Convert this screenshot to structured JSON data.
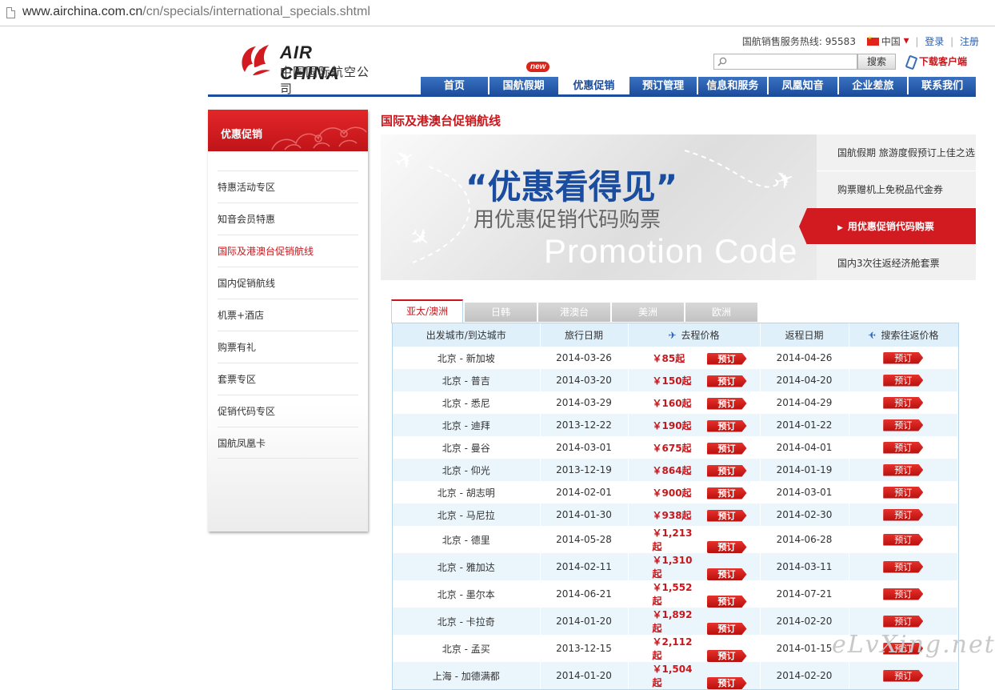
{
  "browser": {
    "url_host": "www.airchina.com.cn",
    "url_path": "/cn/specials/international_specials.shtml"
  },
  "brand": {
    "name_en": "AIR CHINA",
    "name_cn": "中国国际航空公司"
  },
  "topbar": {
    "hotline": "国航销售服务热线: 95583",
    "language": "中国",
    "login": "登录",
    "register": "注册",
    "search_button": "搜索",
    "search_placeholder": "",
    "download": "下载客户端"
  },
  "nav": {
    "new_badge": "new",
    "items": [
      {
        "label": "首页"
      },
      {
        "label": "国航假期"
      },
      {
        "label": "优惠促销"
      },
      {
        "label": "预订管理"
      },
      {
        "label": "信息和服务"
      },
      {
        "label": "凤凰知音"
      },
      {
        "label": "企业差旅"
      },
      {
        "label": "联系我们"
      }
    ]
  },
  "sidebar": {
    "title": "优惠促销",
    "items": [
      {
        "label": "特惠活动专区"
      },
      {
        "label": "知音会员特惠"
      },
      {
        "label": "国际及港澳台促销航线"
      },
      {
        "label": "国内促销航线"
      },
      {
        "label": "机票+酒店"
      },
      {
        "label": "购票有礼"
      },
      {
        "label": "套票专区"
      },
      {
        "label": "促销代码专区"
      },
      {
        "label": "国航凤凰卡"
      }
    ]
  },
  "page": {
    "title": "国际及港澳台促销航线"
  },
  "banner": {
    "headline": "“优惠看得见”",
    "subline": "用优惠促销代码购票",
    "english": "Promotion  Code",
    "side_items": [
      {
        "label": "国航假期 旅游度假预订上佳之选"
      },
      {
        "label": "购票赠机上免税品代金券"
      },
      {
        "label": "用优惠促销代码购票"
      },
      {
        "label": "国内3次往返经济舱套票"
      }
    ]
  },
  "tabs": [
    {
      "label": "亚太/澳洲"
    },
    {
      "label": "日韩"
    },
    {
      "label": "港澳台"
    },
    {
      "label": "美洲"
    },
    {
      "label": "欧洲"
    }
  ],
  "table": {
    "headers": [
      "出发城市/到达城市",
      "旅行日期",
      "去程价格",
      "返程日期",
      "搜索往返价格"
    ],
    "book_label": "预订",
    "rows": [
      {
        "route": "北京 - 新加坡",
        "date": "2014-03-26",
        "price": "￥85起",
        "return": "2014-04-26"
      },
      {
        "route": "北京 - 普吉",
        "date": "2014-03-20",
        "price": "￥150起",
        "return": "2014-04-20"
      },
      {
        "route": "北京 - 悉尼",
        "date": "2014-03-29",
        "price": "￥160起",
        "return": "2014-04-29"
      },
      {
        "route": "北京 - 迪拜",
        "date": "2013-12-22",
        "price": "￥190起",
        "return": "2014-01-22"
      },
      {
        "route": "北京 - 曼谷",
        "date": "2014-03-01",
        "price": "￥675起",
        "return": "2014-04-01"
      },
      {
        "route": "北京 - 仰光",
        "date": "2013-12-19",
        "price": "￥864起",
        "return": "2014-01-19"
      },
      {
        "route": "北京 - 胡志明",
        "date": "2014-02-01",
        "price": "￥900起",
        "return": "2014-03-01"
      },
      {
        "route": "北京 - 马尼拉",
        "date": "2014-01-30",
        "price": "￥938起",
        "return": "2014-02-30"
      },
      {
        "route": "北京 - 德里",
        "date": "2014-05-28",
        "price": "￥1,213起",
        "return": "2014-06-28"
      },
      {
        "route": "北京 - 雅加达",
        "date": "2014-02-11",
        "price": "￥1,310起",
        "return": "2014-03-11"
      },
      {
        "route": "北京 - 墨尔本",
        "date": "2014-06-21",
        "price": "￥1,552起",
        "return": "2014-07-21"
      },
      {
        "route": "北京 - 卡拉奇",
        "date": "2014-01-20",
        "price": "￥1,892起",
        "return": "2014-02-20"
      },
      {
        "route": "北京 - 孟买",
        "date": "2013-12-15",
        "price": "￥2,112起",
        "return": "2014-01-15"
      },
      {
        "route": "上海 - 加德满都",
        "date": "2014-01-20",
        "price": "￥1,504起",
        "return": "2014-02-20"
      }
    ]
  },
  "watermark": "eLvXing.net",
  "colors": {
    "brand_red": "#c9161b",
    "nav_blue": "#1b4d9c",
    "table_head": "#dff0fb"
  }
}
